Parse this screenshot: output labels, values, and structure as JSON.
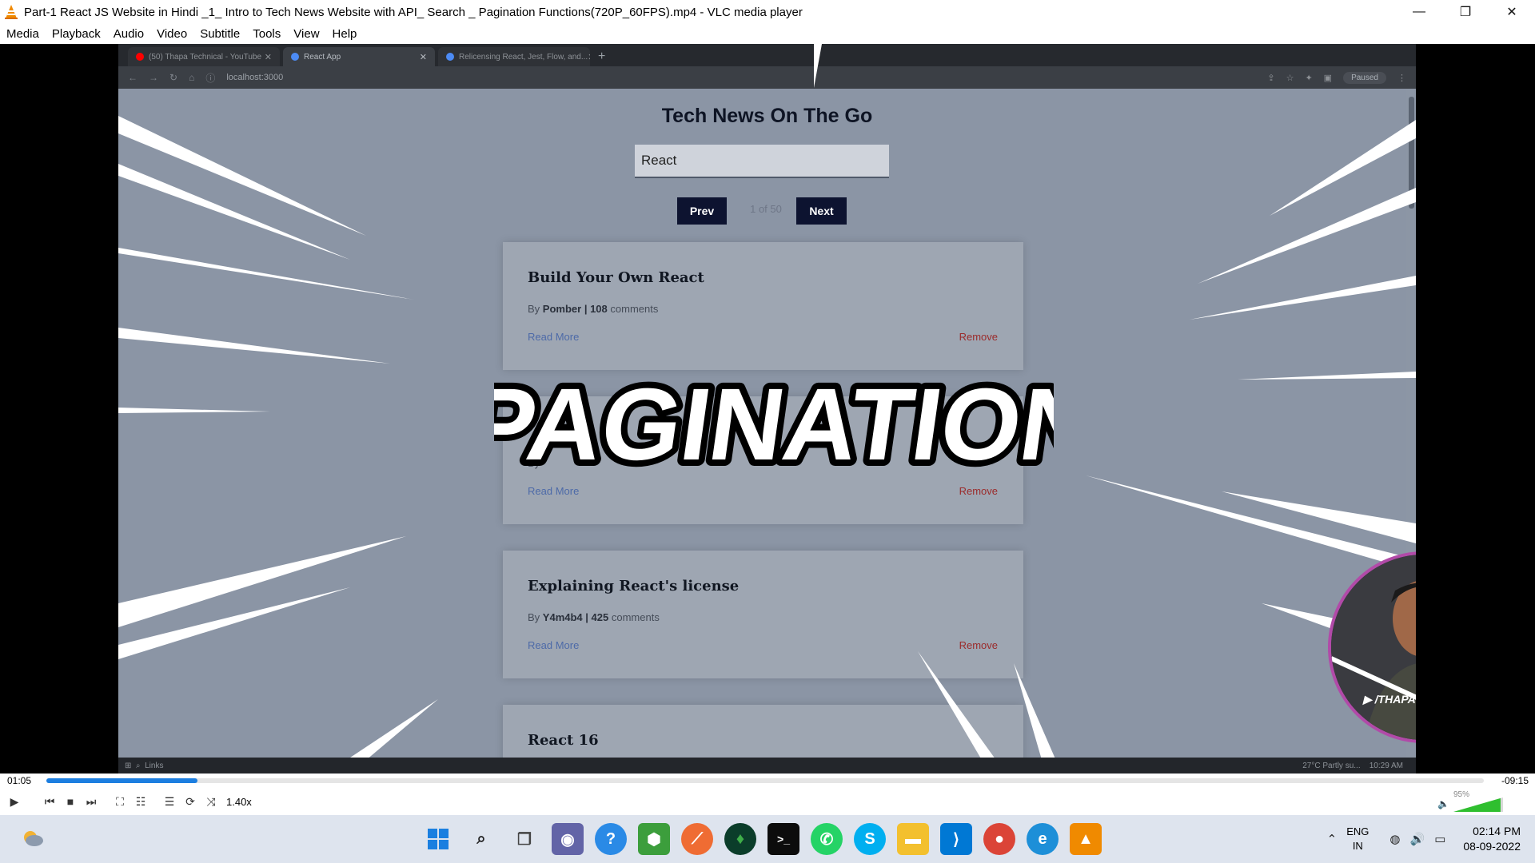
{
  "window": {
    "title": "Part-1  React JS Website in Hindi _1_ Intro to Tech News Website with API_ Search _ Pagination Functions(720P_60FPS).mp4 - VLC media player",
    "minimize": "—",
    "maximize": "❐",
    "close": "✕"
  },
  "menu": [
    "Media",
    "Playback",
    "Audio",
    "Video",
    "Subtitle",
    "Tools",
    "View",
    "Help"
  ],
  "browser": {
    "tabs": [
      {
        "label": "(50) Thapa Technical - YouTube"
      },
      {
        "label": "React App"
      },
      {
        "label": "Relicensing React, Jest, Flow, and..."
      }
    ],
    "url": "localhost:3000",
    "profile_status": "Paused"
  },
  "app": {
    "title": "Tech News On The Go",
    "search_value": "React",
    "prev_label": "Prev",
    "next_label": "Next",
    "page_info": "1 of 50",
    "cards": [
      {
        "title": "Build Your Own React",
        "by_prefix": "By ",
        "author": "Pomber",
        "sep": " | ",
        "count": "108",
        "comments_word": " comments",
        "read_more": "Read More",
        "remove": "Remove"
      },
      {
        "title": "",
        "by_prefix": "By ",
        "author": "",
        "sep": "",
        "count": "",
        "comments_word": "",
        "read_more": "Read More",
        "remove": "Remove"
      },
      {
        "title": "Explaining React's license",
        "by_prefix": "By ",
        "author": "Y4m4b4",
        "sep": " | ",
        "count": "425",
        "comments_word": " comments",
        "read_more": "Read More",
        "remove": "Remove"
      },
      {
        "title": "React 16",
        "by_prefix": "",
        "author": "",
        "sep": "",
        "count": "",
        "comments_word": "",
        "read_more": "",
        "remove": ""
      }
    ]
  },
  "overlay": {
    "text": "PAGINATION"
  },
  "webcam": {
    "label": "/THAPATECHNICAL"
  },
  "inner_taskbar": {
    "links": "Links",
    "weather": "27°C  Partly su...",
    "time": "10:29 AM"
  },
  "player": {
    "elapsed": "01:05",
    "remaining": "-09:15",
    "progress_fraction": 0.105,
    "speed": "1.40x",
    "volume": "95%",
    "volume_fraction": 0.95
  },
  "taskbar": {
    "lang_line1": "ENG",
    "lang_line2": "IN",
    "time": "02:14 PM",
    "date": "08-09-2022",
    "icons": [
      "windows-start-icon",
      "search-icon",
      "task-view-icon",
      "teams-chat-icon",
      "help-icon",
      "node-icon",
      "postman-icon",
      "mongodb-icon",
      "terminal-icon",
      "whatsapp-icon",
      "skype-icon",
      "file-explorer-icon",
      "vscode-icon",
      "chrome-icon",
      "edge-icon",
      "vlc-icon"
    ]
  },
  "colors": {
    "accent": "#0d1330",
    "remove": "#9b2b2b",
    "link": "#4d6aa8",
    "seek": "#1c7ee0"
  }
}
